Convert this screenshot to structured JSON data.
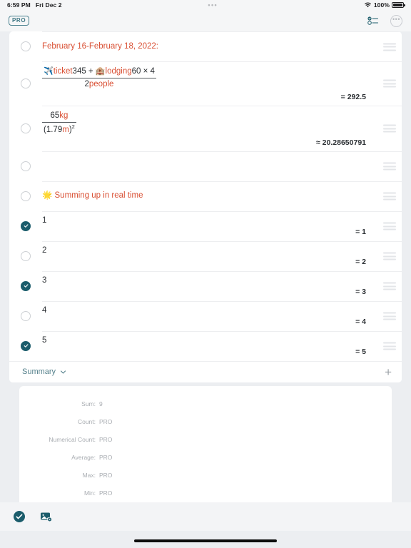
{
  "status_bar": {
    "time": "6:59 PM",
    "date": "Fri Dec 2",
    "center_dots": "•••",
    "battery_percent": "100%",
    "wifi_icon": "wifi-icon",
    "battery_icon": "battery-icon"
  },
  "top_bar": {
    "pro_badge": "PRO",
    "list_icon": "checklist-icon",
    "more_icon": "more-options-icon"
  },
  "rows": [
    {
      "id": "date-header",
      "checked": false,
      "type": "text",
      "text": "February 16-February 18, 2022:",
      "result": ""
    },
    {
      "id": "trip-cost",
      "checked": false,
      "type": "fraction",
      "numerator": [
        {
          "t": "emoji",
          "v": "✈️"
        },
        {
          "t": "unit",
          "v": "ticket"
        },
        {
          "t": "lit",
          "v": "345"
        },
        {
          "t": "lit",
          "v": " + "
        },
        {
          "t": "emoji",
          "v": "🏨"
        },
        {
          "t": "unit",
          "v": "lodging"
        },
        {
          "t": "lit",
          "v": "60 × 4"
        }
      ],
      "denominator": [
        {
          "t": "lit",
          "v": "2"
        },
        {
          "t": "unit",
          "v": "people"
        }
      ],
      "result": "= 292.5"
    },
    {
      "id": "bmi",
      "checked": false,
      "type": "fraction",
      "numerator": [
        {
          "t": "lit",
          "v": "65"
        },
        {
          "t": "unit",
          "v": "kg"
        }
      ],
      "denominator": [
        {
          "t": "lit",
          "v": "(1.79"
        },
        {
          "t": "unit",
          "v": "m"
        },
        {
          "t": "lit",
          "v": ")"
        },
        {
          "t": "sup",
          "v": "2"
        }
      ],
      "result": "≈ 20.28650791"
    },
    {
      "id": "blank",
      "checked": false,
      "type": "empty",
      "text": "",
      "result": ""
    },
    {
      "id": "summing-note",
      "checked": false,
      "type": "text",
      "text": "🌟 Summing up in real time",
      "result": ""
    },
    {
      "id": "item-1",
      "checked": true,
      "type": "number",
      "text": "1",
      "result": "= 1"
    },
    {
      "id": "item-2",
      "checked": false,
      "type": "number",
      "text": "2",
      "result": "= 2"
    },
    {
      "id": "item-3",
      "checked": true,
      "type": "number",
      "text": "3",
      "result": "= 3"
    },
    {
      "id": "item-4",
      "checked": false,
      "type": "number",
      "text": "4",
      "result": "= 4"
    },
    {
      "id": "item-5",
      "checked": true,
      "type": "number",
      "text": "5",
      "result": "= 5"
    }
  ],
  "summary_bar": {
    "label": "Summary",
    "chevron_icon": "chevron-down-icon",
    "add_label": "+"
  },
  "summary_panel": [
    {
      "key": "Sum:",
      "value": "9"
    },
    {
      "key": "Count:",
      "value": "PRO"
    },
    {
      "key": "Numerical Count:",
      "value": "PRO"
    },
    {
      "key": "Average:",
      "value": "PRO"
    },
    {
      "key": "Max:",
      "value": "PRO"
    },
    {
      "key": "Min:",
      "value": "PRO"
    }
  ],
  "bottom_bar": {
    "check_icon": "check-circle-icon",
    "image_settings_icon": "image-settings-icon"
  },
  "colors": {
    "accent_teal": "#1b5c6b",
    "expression_red": "#d94f33",
    "page_background": "#eceef1",
    "card_background": "#ffffff",
    "muted_text": "#a9adb2"
  }
}
